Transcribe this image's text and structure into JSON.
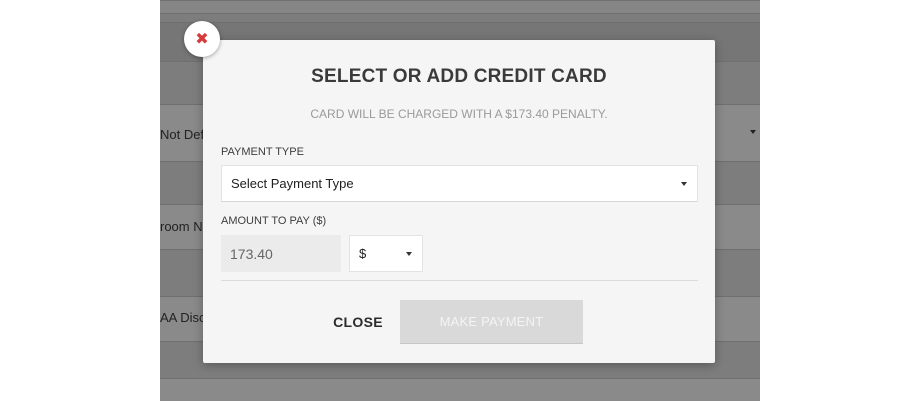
{
  "background": {
    "labels": [
      "Not Def",
      "room N",
      "AA Disc"
    ]
  },
  "modal": {
    "title": "SELECT OR ADD CREDIT CARD",
    "subtitle": "CARD WILL BE CHARGED WITH A $173.40 PENALTY.",
    "close_icon": "x-icon",
    "payment_type": {
      "label": "PAYMENT TYPE",
      "selected": "Select Payment Type"
    },
    "amount": {
      "label": "AMOUNT TO PAY ($)",
      "value": "173.40",
      "currency": "$"
    },
    "buttons": {
      "close": "CLOSE",
      "make_payment": "MAKE PAYMENT"
    }
  },
  "colors": {
    "close_icon": "#d63a3a",
    "modal_bg": "#f5f5f5",
    "disabled_button": "#d9d9d9"
  }
}
